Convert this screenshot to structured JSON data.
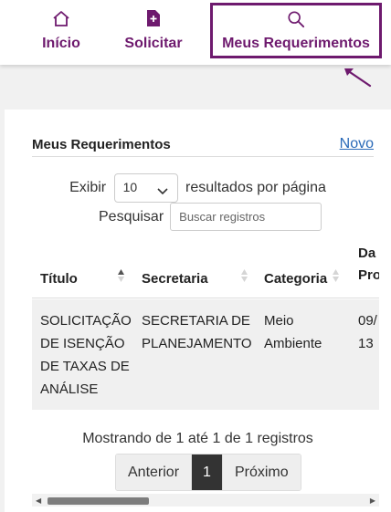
{
  "nav": {
    "items": [
      {
        "label": "Início",
        "icon": "home-icon"
      },
      {
        "label": "Solicitar",
        "icon": "document-plus-icon"
      },
      {
        "label": "Meus Requerimentos",
        "icon": "search-icon"
      }
    ],
    "accent_color": "#6e1a6e"
  },
  "card": {
    "title": "Meus Requerimentos",
    "new_link": "Novo"
  },
  "table_controls": {
    "show_label": "Exibir",
    "page_size": "10",
    "per_page_label": "resultados por página",
    "search_label": "Pesquisar",
    "search_placeholder": "Buscar registros"
  },
  "table": {
    "columns": [
      "Título",
      "Secretaria",
      "Categoria",
      "Da\nPro"
    ],
    "rows": [
      [
        "SOLICITAÇÃO DE ISENÇÃO DE TAXAS DE ANÁLISE",
        "SECRETARIA DE PLANEJAMENTO",
        "Meio Ambiente",
        "09/ 13"
      ]
    ]
  },
  "footer": {
    "info": "Mostrando de 1 até 1 de 1 registros",
    "prev": "Anterior",
    "current_page": "1",
    "next": "Próximo"
  }
}
